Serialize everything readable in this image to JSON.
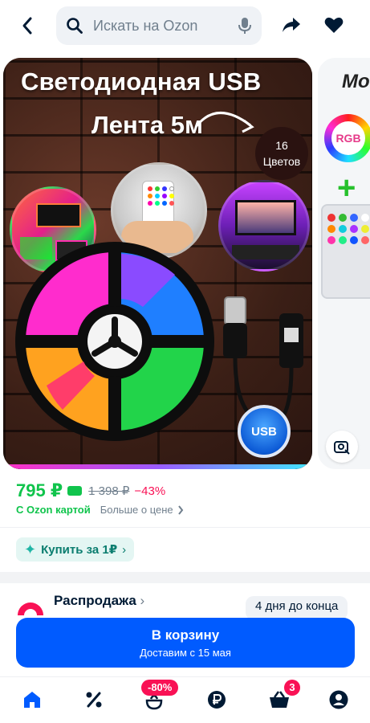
{
  "header": {
    "search_placeholder": "Искать на Ozon",
    "icons": [
      "back-arrow-icon",
      "search-icon",
      "microphone-icon",
      "share-icon",
      "heart-icon"
    ]
  },
  "gallery": {
    "title_line1": "Светодиодная USB",
    "title_line2": "Лента 5м",
    "colors_count": "16",
    "colors_label": "Цветов",
    "usb_label": "USB",
    "next_title": "Мо",
    "next_rgb": "RGB"
  },
  "price": {
    "current": "795 ₽",
    "old": "1 398 ₽",
    "discount": "−43%",
    "ozon_card": "С Ozon картой",
    "more": "Больше о цене"
  },
  "promo": {
    "buy_label": "Купить за 1₽"
  },
  "sale": {
    "title": "Распродажа",
    "days_left": "4 дня до конца"
  },
  "cart": {
    "label": "В корзину",
    "delivery": "Доставим с 15 мая"
  },
  "bottom_nav": {
    "items": [
      "home-icon",
      "percent-icon",
      "fresh-icon",
      "ruble-icon",
      "basket-icon",
      "profile-icon"
    ],
    "deals_badge": "-80%",
    "cart_badge": "3"
  },
  "colors": {
    "accent_blue": "#005bff",
    "price_green": "#10c44c",
    "discount_red": "#f91155"
  }
}
